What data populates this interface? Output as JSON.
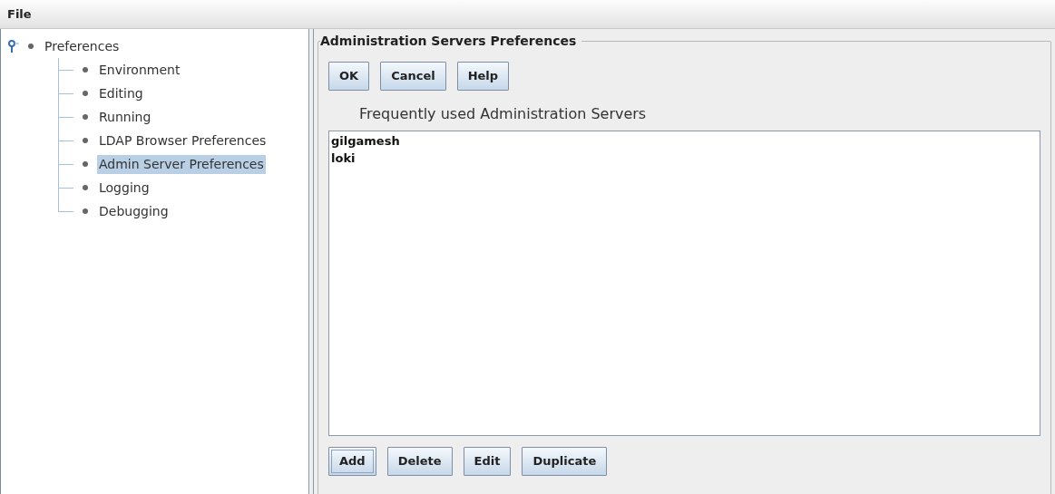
{
  "menu_bar": [
    "File"
  ],
  "tree": {
    "label": "Preferences",
    "expanded": true,
    "selected": false,
    "children": [
      {
        "label": "Environment",
        "selected": false
      },
      {
        "label": "Editing",
        "selected": false
      },
      {
        "label": "Running",
        "selected": false
      },
      {
        "label": "LDAP Browser Preferences",
        "selected": false
      },
      {
        "label": "Admin Server Preferences",
        "selected": true
      },
      {
        "label": "Logging",
        "selected": false
      },
      {
        "label": "Debugging",
        "selected": false
      }
    ]
  },
  "panel": {
    "title": "Administration Servers Preferences",
    "top_buttons": [
      {
        "label": "OK",
        "focused": false
      },
      {
        "label": "Cancel",
        "focused": false
      },
      {
        "label": "Help",
        "focused": false
      }
    ],
    "list_caption": "Frequently used Administration Servers",
    "servers": [
      "gilgamesh",
      "loki"
    ],
    "bottom_buttons": [
      {
        "label": "Add",
        "focused": true
      },
      {
        "label": "Delete",
        "focused": false
      },
      {
        "label": "Edit",
        "focused": false
      },
      {
        "label": "Duplicate",
        "focused": false
      }
    ]
  }
}
